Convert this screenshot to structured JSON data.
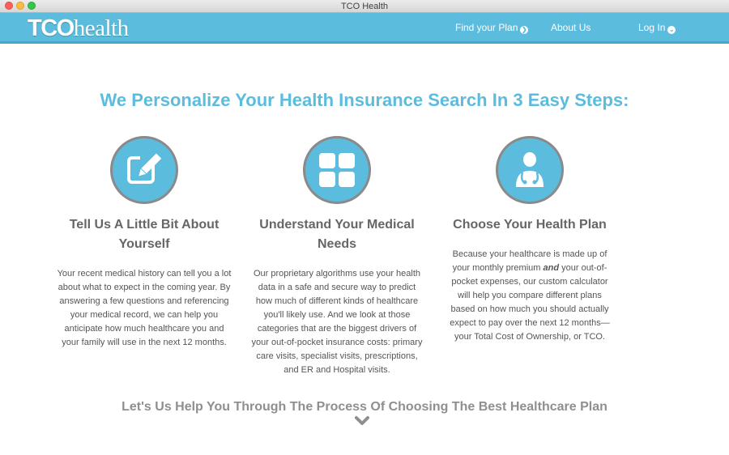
{
  "window": {
    "title": "TCO Health"
  },
  "navbar": {
    "logo_bold": "TCO",
    "logo_light": "health",
    "items": [
      {
        "label": "Find your Plan",
        "icon": "circle-arrow-right-icon"
      },
      {
        "label": "About Us",
        "icon": ""
      },
      {
        "label": "Log In",
        "icon": "circle-chevron-down-icon"
      }
    ],
    "color": "#5bbcdd"
  },
  "headline": "We Personalize Your Health Insurance Search In 3 Easy Steps:",
  "steps": [
    {
      "icon": "edit-form-icon",
      "title": "Tell Us A Little Bit About Yourself",
      "text": "Your recent medical history can tell you a lot about what to expect in the coming year. By answering a few questions and referencing your medical record, we can help you anticipate how much healthcare you and your family will use in the next 12 months."
    },
    {
      "icon": "grid-blocks-icon",
      "title": "Understand Your Medical Needs",
      "text": "Our proprietary algorithms use your health data in a safe and secure way to predict how much of different kinds of healthcare you'll likely use. And we look at those categories that are the biggest drivers of your out-of-pocket insurance costs: primary care visits, specialist visits, prescriptions, and ER and Hospital visits."
    },
    {
      "icon": "doctor-stethoscope-icon",
      "title": "Choose Your Health Plan",
      "text_before": "Because your healthcare is made up of your monthly premium ",
      "text_emphasis": "and",
      "text_after": " your out-of-pocket expenses, our custom calculator will help you compare different plans based on how much you should actually expect to pay over the next 12 months—your Total Cost of Ownership, or TCO."
    }
  ],
  "bottom_cta": "Let's Us Help You Through The Process Of Choosing The Best Healthcare Plan",
  "scroll_icon": "chevron-down-icon"
}
